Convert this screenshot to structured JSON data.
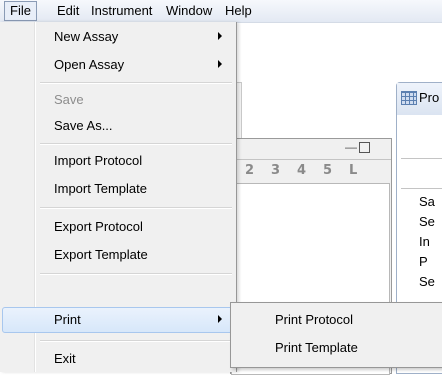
{
  "menubar": {
    "items": [
      "File",
      "Edit",
      "Instrument",
      "Window",
      "Help"
    ]
  },
  "file_menu": {
    "new_assay": "New Assay",
    "open_assay": "Open Assay",
    "save": "Save",
    "save_as": "Save As...",
    "import_protocol": "Import Protocol",
    "import_template": "Import Template",
    "export_protocol": "Export Protocol",
    "export_template": "Export Template",
    "print": "Print",
    "exit": "Exit"
  },
  "print_submenu": {
    "print_protocol": "Print Protocol",
    "print_template": "Print Template"
  },
  "background": {
    "right_panel_title": "Pro",
    "ruler_numbers": [
      "2",
      "3",
      "4",
      "5",
      "L"
    ],
    "row_labels": [
      "Sa",
      "Se",
      "In",
      "P",
      "Se"
    ]
  }
}
